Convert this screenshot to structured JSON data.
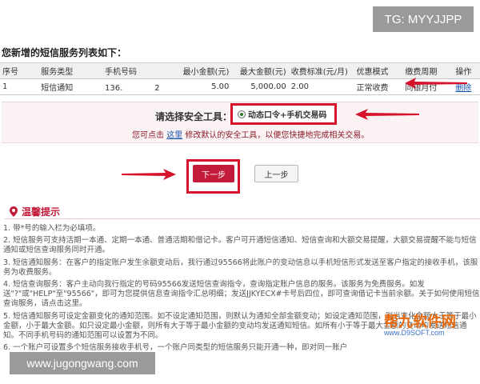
{
  "watermark": {
    "tg": "TG: MYYJJPP",
    "url": "www.jugongwang.com",
    "logo_text": "帮九软件网",
    "logo_sub": "www.D9SOFT.com"
  },
  "section_title": "您新增的短信服务列表如下：",
  "table": {
    "headers": [
      "序号",
      "服务类型",
      "手机号码",
      "最小金额(元)",
      "最大金额(元)",
      "收费标准(元/月)",
      "优惠模式",
      "缴费周期",
      "操作"
    ],
    "rows": [
      [
        "1",
        "短信通知",
        "136.　　　　2",
        "5.00",
        "5,000.00",
        "2.00",
        "正常收费",
        "同银月付",
        "删除"
      ]
    ]
  },
  "security": {
    "label": "请选择安全工具：",
    "option": "动态口令+手机交易码",
    "note_prefix": "您可点击",
    "note_link": "这里",
    "note_suffix": "修改默认的安全工具，以便您快捷地完成相关交易。"
  },
  "buttons": {
    "next": "下一步",
    "prev": "上一步"
  },
  "tips": {
    "title": "温馨提示",
    "items": [
      "1. 带*号的输入栏为必填项。",
      "2. 短信服务可支持活期一本通、定期一本通、普通活期和借记卡。客户可开通短信通知、短信查询和大额交易提醒，大额交易提醒不能与短信通知或短信查询服务同时开通。",
      "3. 短信通知服务：在客户的指定账户发生余额变动后，我行通过95566将此账户的变动信息以手机短信形式发送至客户指定的接收手机，该服务为收费服务。",
      "4. 短信查询服务：客户主动向我行指定的号码95566发送短信查询指令，查询指定账户信息的服务。该服务为免费服务。如发送\"?\"或\"HELP\"至\"95566\"，即可为您提供信息查询指令汇总明细；发送JJKYECX#卡号后四位，即可查询借记卡当前余额。关于如何使用短信查询服务，请点击这里。",
      "5. 短信通知服务可设定金额变化的通知范围。如不设定通知范围，则默认为通知全部金额变动；如设定通知范围，则当变化金额大于等于最小金额，小于最大金额。如只设定最小金额，则所有大于等于最小金额的变动均发送通知短信。如所有小于等于最大金额的变动均发送短信通知。不同手机号码的通知范围可以设置为不同。",
      "6. 一个账户可设置多个短信服务接收手机号，一个账户同类型的短信服务只能开通一种，即对同一账户"
    ]
  }
}
